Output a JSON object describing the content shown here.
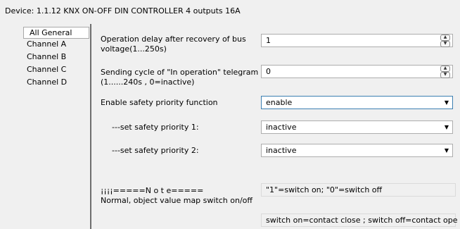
{
  "device_title": "Device: 1.1.12  KNX ON-OFF DIN CONTROLLER 4 outputs 16A",
  "sidebar": {
    "items": [
      {
        "label": "All General"
      },
      {
        "label": "Channel A"
      },
      {
        "label": "Channel B"
      },
      {
        "label": "Channel C"
      },
      {
        "label": "Channel D"
      }
    ]
  },
  "params": {
    "op_delay": {
      "label_line1": "Operation delay after recovery of bus",
      "label_line2": "voltage(1...250s)",
      "value": "1"
    },
    "send_cycle": {
      "label_line1": "Sending cycle of \"In operation\" telegram",
      "label_line2": "(1......240s , 0=inactive)",
      "value": "0"
    },
    "safety_enable": {
      "label": "Enable safety priority function",
      "value": "enable"
    },
    "safety_1": {
      "label": "---set safety priority 1:",
      "value": "inactive"
    },
    "safety_2": {
      "label": "---set safety priority 2:",
      "value": "inactive"
    },
    "note": {
      "label_line1": "¡¡¡¡=====N o t e=====",
      "label_line2": "Normal, object value map switch on/off",
      "text1": "\"1\"=switch on; \"0\"=switch off",
      "text2": "switch on=contact close ; switch off=contact ope"
    }
  },
  "icons": {
    "spin_up": "▲",
    "spin_down": "▼",
    "dropdown": "▼"
  }
}
